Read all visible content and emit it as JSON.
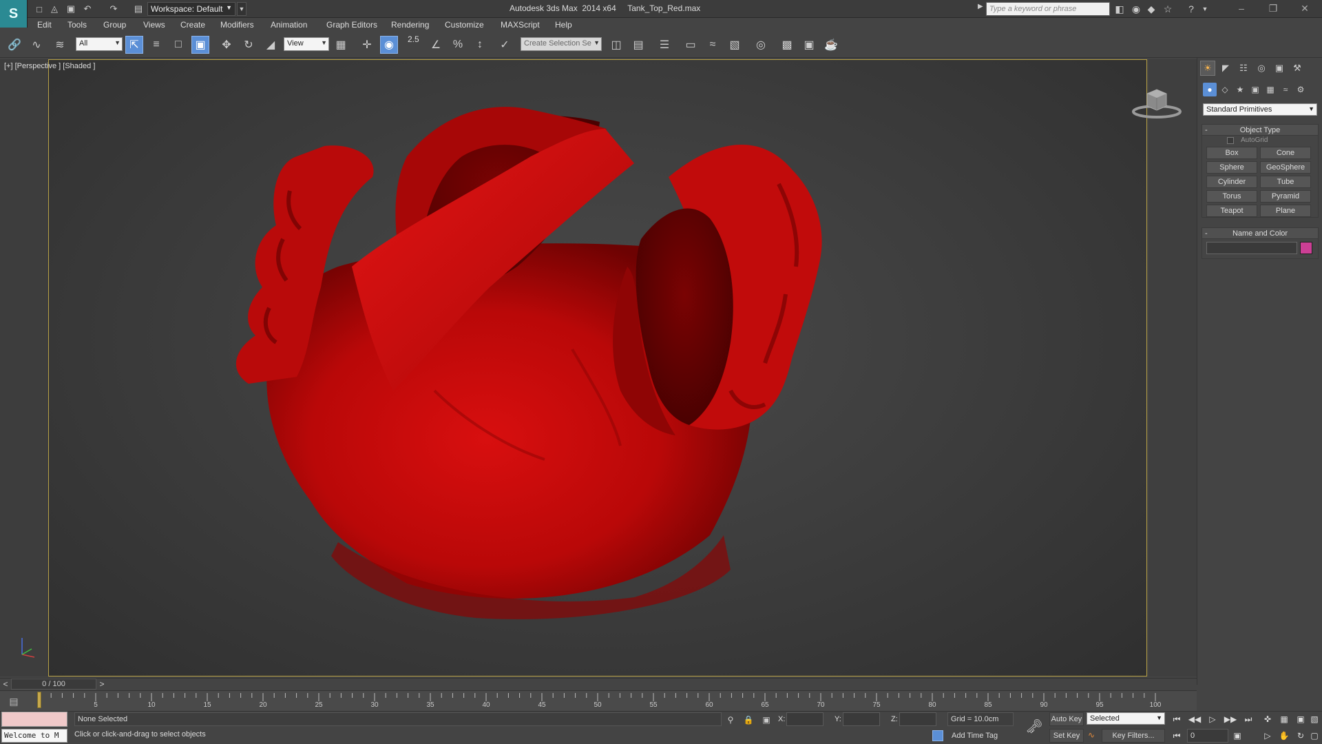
{
  "titlebar": {
    "workspace": "Workspace: Default",
    "app_title": "Autodesk 3ds Max  2014 x64     Tank_Top_Red.max",
    "search_placeholder": "Type a keyword or phrase"
  },
  "menu": [
    "Edit",
    "Tools",
    "Group",
    "Views",
    "Create",
    "Modifiers",
    "Animation",
    "Graph Editors",
    "Rendering",
    "Customize",
    "MAXScript",
    "Help"
  ],
  "toolbar": {
    "selection_filter": "All",
    "ref_coord": "View",
    "angle_snap_label": "2.5",
    "named_selection": "Create Selection Se"
  },
  "viewport": {
    "label": "[+] [Perspective ] [Shaded ]",
    "object_color": "#c40a0a"
  },
  "command_panel": {
    "category": "Standard Primitives",
    "object_type_title": "Object Type",
    "autogrid_label": "AutoGrid",
    "primitives": [
      "Box",
      "Cone",
      "Sphere",
      "GeoSphere",
      "Cylinder",
      "Tube",
      "Torus",
      "Pyramid",
      "Teapot",
      "Plane"
    ],
    "name_color_title": "Name and Color",
    "swatch_color": "#cc3f95"
  },
  "timeline": {
    "frame_display": "0 / 100",
    "ticks": [
      "5",
      "10",
      "15",
      "20",
      "25",
      "30",
      "35",
      "40",
      "45",
      "50",
      "55",
      "60",
      "65",
      "70",
      "75",
      "80",
      "85",
      "90",
      "95",
      "100"
    ]
  },
  "status": {
    "maxscript_output": "Welcome to M",
    "selection": "None Selected",
    "prompt": "Click or click-and-drag to select objects",
    "x_label": "X:",
    "y_label": "Y:",
    "z_label": "Z:",
    "grid": "Grid = 10.0cm",
    "add_time_tag": "Add Time Tag",
    "auto_key": "Auto Key",
    "set_key": "Set Key",
    "key_mode": "Selected",
    "key_filters": "Key Filters...",
    "current_frame": "0"
  }
}
